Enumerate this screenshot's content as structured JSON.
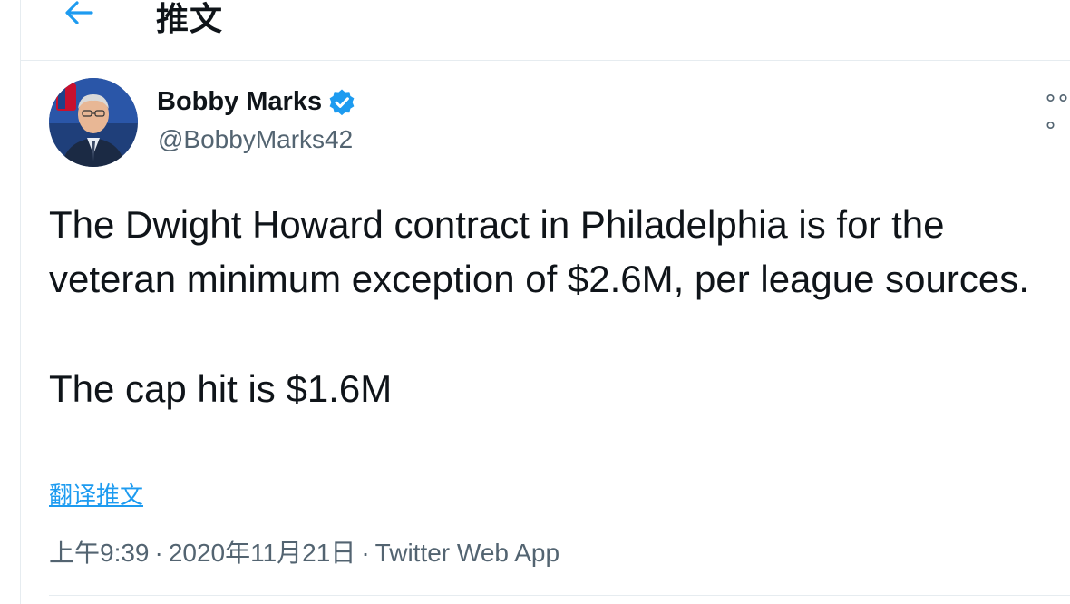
{
  "header": {
    "back_icon": "arrow-left-icon",
    "title": "推文"
  },
  "tweet": {
    "author": {
      "display_name": "Bobby Marks",
      "handle": "@BobbyMarks42",
      "verified": true,
      "verified_icon": "verified-badge-icon"
    },
    "more_icon": "more-options-icon",
    "more_label": "°°°",
    "text_paragraph_1": "The Dwight Howard contract in Philadelphia is for the veteran minimum exception of $2.6M, per league sources.",
    "text_paragraph_2": "The cap hit is $1.6M",
    "translate_label": "翻译推文",
    "time": "上午9:39",
    "date": "2020年11月21日",
    "separator": "·",
    "source": "Twitter Web App"
  },
  "colors": {
    "accent": "#1d9bf0",
    "text_primary": "#0f1419",
    "text_secondary": "#536471",
    "divider": "#e6ecf0"
  }
}
